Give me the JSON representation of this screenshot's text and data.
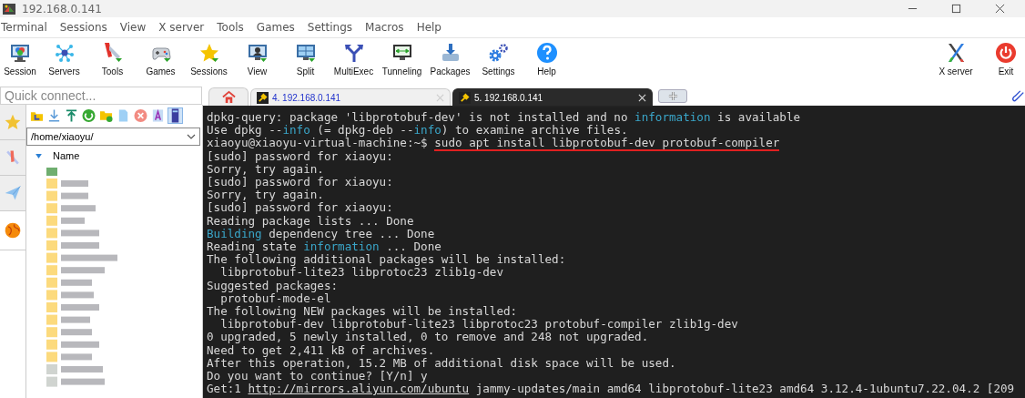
{
  "window": {
    "title": "192.168.0.141"
  },
  "menu": [
    "Terminal",
    "Sessions",
    "View",
    "X server",
    "Tools",
    "Games",
    "Settings",
    "Macros",
    "Help"
  ],
  "toolbar": [
    {
      "label": "Session"
    },
    {
      "label": "Servers"
    },
    {
      "label": "Tools"
    },
    {
      "label": "Games"
    },
    {
      "label": "Sessions"
    },
    {
      "label": "View"
    },
    {
      "label": "Split"
    },
    {
      "label": "MultiExec"
    },
    {
      "label": "Tunneling"
    },
    {
      "label": "Packages"
    },
    {
      "label": "Settings"
    },
    {
      "label": "Help"
    }
  ],
  "toolbar_right": [
    {
      "label": "X server"
    },
    {
      "label": "Exit"
    }
  ],
  "quick_connect": {
    "placeholder": "Quick connect..."
  },
  "side_tabs": [
    {
      "selected": false
    },
    {
      "selected": false
    },
    {
      "selected": false
    },
    {
      "selected": true
    }
  ],
  "file_browser": {
    "path": "/home/xiaoyu/",
    "column": "Name"
  },
  "tabs": [
    {
      "label": "4. 192.168.0.141",
      "selected": false
    },
    {
      "label": "5. 192.168.0.141",
      "selected": true
    }
  ],
  "terminal": {
    "lines": [
      [
        {
          "text": "dpkg-query: package 'libprotobuf-dev' is not installed and no ",
          "kind": "plain"
        },
        {
          "text": "information",
          "kind": "cyan"
        },
        {
          "text": " is available",
          "kind": "plain"
        }
      ],
      [
        {
          "text": "Use dpkg --",
          "kind": "plain"
        },
        {
          "text": "info",
          "kind": "cyan"
        },
        {
          "text": " (= dpkg-deb --",
          "kind": "plain"
        },
        {
          "text": "info",
          "kind": "cyan"
        },
        {
          "text": ") to examine archive files.",
          "kind": "plain"
        }
      ],
      [
        {
          "text": "xiaoyu@xiaoyu-virtual-machine:~$ ",
          "kind": "plain"
        },
        {
          "text": "sudo apt install libprotobuf-dev protobuf-compiler",
          "kind": "command"
        }
      ],
      [
        {
          "text": "[sudo] password for xiaoyu:",
          "kind": "plain"
        }
      ],
      [
        {
          "text": "Sorry, try again.",
          "kind": "plain"
        }
      ],
      [
        {
          "text": "[sudo] password for xiaoyu:",
          "kind": "plain"
        }
      ],
      [
        {
          "text": "Sorry, try again.",
          "kind": "plain"
        }
      ],
      [
        {
          "text": "[sudo] password for xiaoyu:",
          "kind": "plain"
        }
      ],
      [
        {
          "text": "Reading package lists ... Done",
          "kind": "plain"
        }
      ],
      [
        {
          "text": "Building",
          "kind": "cyan"
        },
        {
          "text": " dependency tree ... Done",
          "kind": "plain"
        }
      ],
      [
        {
          "text": "Reading state ",
          "kind": "plain"
        },
        {
          "text": "information",
          "kind": "cyan"
        },
        {
          "text": " ... Done",
          "kind": "plain"
        }
      ],
      [
        {
          "text": "The following additional packages will be installed:",
          "kind": "plain"
        }
      ],
      [
        {
          "text": "  libprotobuf-lite23 libprotoc23 zlib1g-dev",
          "kind": "plain"
        }
      ],
      [
        {
          "text": "Suggested packages:",
          "kind": "plain"
        }
      ],
      [
        {
          "text": "  protobuf-mode-el",
          "kind": "plain"
        }
      ],
      [
        {
          "text": "The following NEW packages will be installed:",
          "kind": "plain"
        }
      ],
      [
        {
          "text": "  libprotobuf-dev libprotobuf-lite23 libprotoc23 protobuf-compiler zlib1g-dev",
          "kind": "plain"
        }
      ],
      [
        {
          "text": "0 upgraded, 5 newly installed, 0 to remove and 248 not upgraded.",
          "kind": "plain"
        }
      ],
      [
        {
          "text": "Need to get 2,411 kB of archives.",
          "kind": "plain"
        }
      ],
      [
        {
          "text": "After this operation, 15.2 MB of additional disk space will be used.",
          "kind": "plain"
        }
      ],
      [
        {
          "text": "Do you want to continue? [Y/n] y",
          "kind": "plain"
        }
      ],
      [
        {
          "text": "Get:1 ",
          "kind": "plain"
        },
        {
          "text": "http://mirrors.aliyun.com/ubuntu",
          "kind": "link"
        },
        {
          "text": " jammy-updates/main amd64 libprotobuf-lite23 amd64 3.12.4-1ubuntu7.22.04.2 [209",
          "kind": "plain"
        }
      ]
    ]
  }
}
